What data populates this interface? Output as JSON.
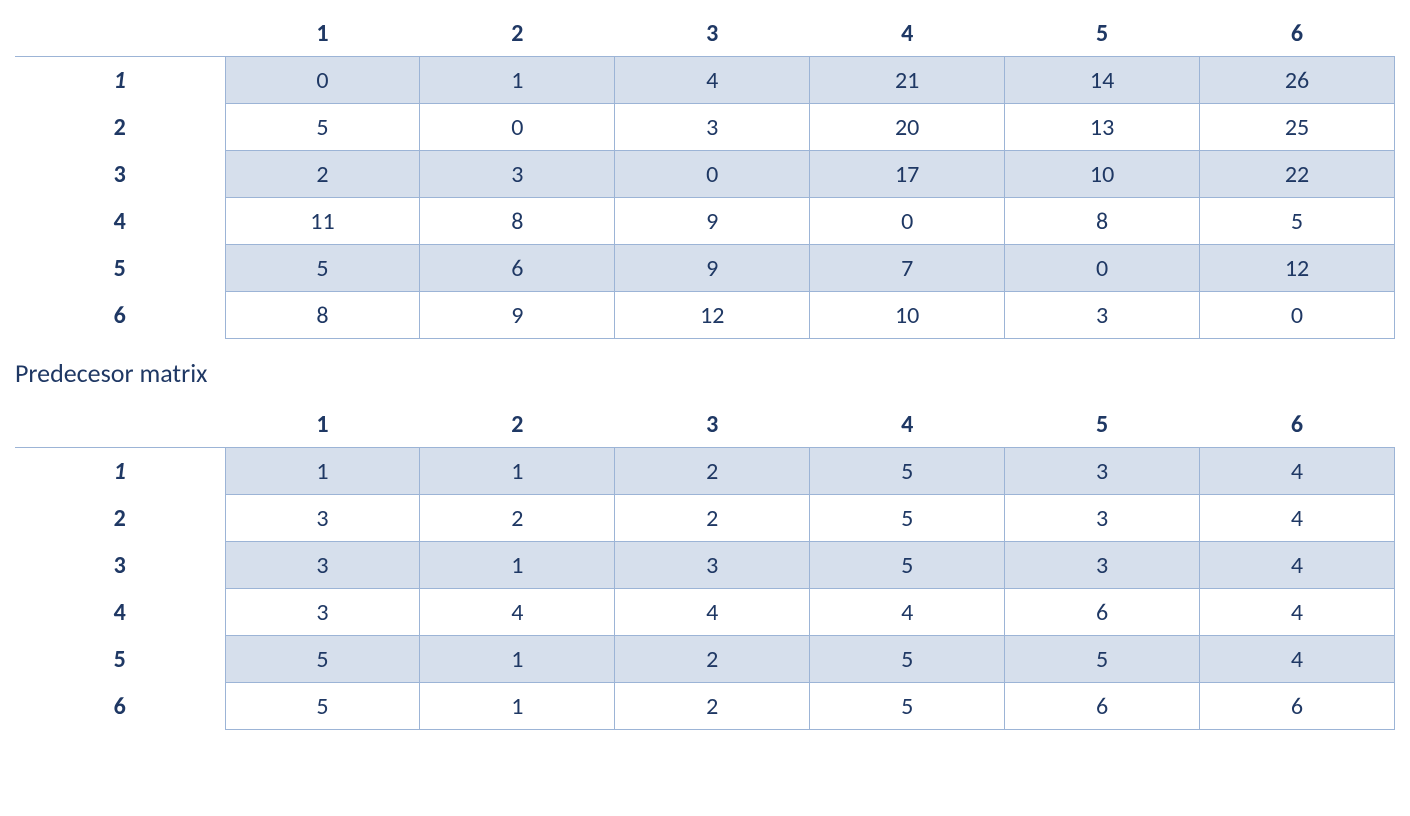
{
  "chart_data": [
    {
      "type": "table",
      "title": "",
      "columns": [
        "1",
        "2",
        "3",
        "4",
        "5",
        "6"
      ],
      "row_headers": [
        "1",
        "2",
        "3",
        "4",
        "5",
        "6"
      ],
      "rows": [
        [
          "0",
          "1",
          "4",
          "21",
          "14",
          "26"
        ],
        [
          "5",
          "0",
          "3",
          "20",
          "13",
          "25"
        ],
        [
          "2",
          "3",
          "0",
          "17",
          "10",
          "22"
        ],
        [
          "11",
          "8",
          "9",
          "0",
          "8",
          "5"
        ],
        [
          "5",
          "6",
          "9",
          "7",
          "0",
          "12"
        ],
        [
          "8",
          "9",
          "12",
          "10",
          "3",
          "0"
        ]
      ]
    },
    {
      "type": "table",
      "title": "Predecesor matrix",
      "columns": [
        "1",
        "2",
        "3",
        "4",
        "5",
        "6"
      ],
      "row_headers": [
        "1",
        "2",
        "3",
        "4",
        "5",
        "6"
      ],
      "rows": [
        [
          "1",
          "1",
          "2",
          "5",
          "3",
          "4"
        ],
        [
          "3",
          "2",
          "2",
          "5",
          "3",
          "4"
        ],
        [
          "3",
          "1",
          "3",
          "5",
          "3",
          "4"
        ],
        [
          "3",
          "4",
          "4",
          "4",
          "6",
          "4"
        ],
        [
          "5",
          "1",
          "2",
          "5",
          "5",
          "4"
        ],
        [
          "5",
          "1",
          "2",
          "5",
          "6",
          "6"
        ]
      ]
    }
  ]
}
